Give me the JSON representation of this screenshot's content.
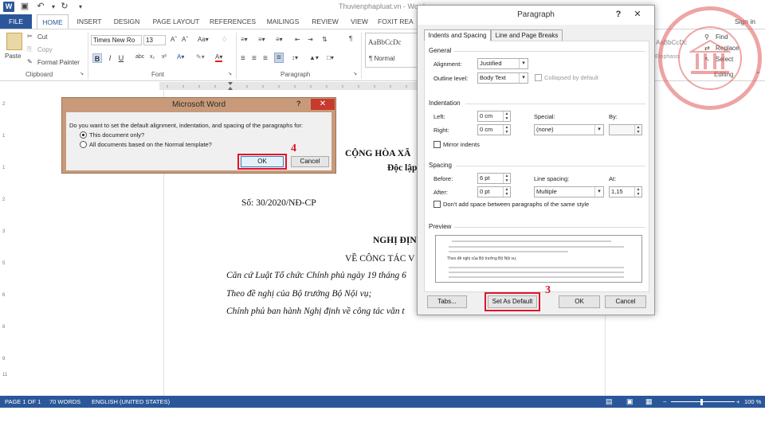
{
  "app": {
    "window_title": "Thuvienphapluat.vn - Word",
    "sign_in": "Sign in"
  },
  "qat": {
    "save_icon": "save-icon",
    "undo_icon": "undo-icon",
    "redo_icon": "redo-icon"
  },
  "tabs": [
    "FILE",
    "HOME",
    "INSERT",
    "DESIGN",
    "PAGE LAYOUT",
    "REFERENCES",
    "MAILINGS",
    "REVIEW",
    "VIEW",
    "FOXIT REA"
  ],
  "ribbon": {
    "clipboard": {
      "paste": "Paste",
      "cut": "Cut",
      "copy": "Copy",
      "format_painter": "Format Painter",
      "label": "Clipboard"
    },
    "font": {
      "font_name": "Times New Ro",
      "font_size": "13",
      "label": "Font"
    },
    "paragraph": {
      "label": "Paragraph"
    },
    "styles": {
      "preview": "AaBbCcDc",
      "normal": "¶ Normal"
    },
    "editing": {
      "find": "Find",
      "replace": "Replace",
      "select": "Select",
      "label": "Editing",
      "style_preview": "AaBbCcDc",
      "emphasis": "Emphasis"
    }
  },
  "document": {
    "heading1": "CỘNG HÒA XÃ",
    "heading2": "Độc lập",
    "number": "Số: 30/2020/NĐ-CP",
    "title1": "NGHỊ ĐỊN",
    "title2": "VỀ CÔNG TÁC V",
    "line1": "Căn cứ Luật Tổ chức Chính phủ ngày 19 tháng 6",
    "line2": "Theo đề nghị của Bộ trưởng Bộ Nội vụ;",
    "line3": "Chính phủ ban hành Nghị định về công tác văn t"
  },
  "status": {
    "page": "PAGE 1 OF 1",
    "words": "70 WORDS",
    "language": "ENGLISH (UNITED STATES)",
    "zoom": "100 %"
  },
  "paragraph_dialog": {
    "title": "Paragraph",
    "help": "?",
    "tabs": [
      "Indents and Spacing",
      "Line and Page Breaks"
    ],
    "general": {
      "label": "General",
      "alignment_label": "Alignment:",
      "alignment_value": "Justified",
      "outline_label": "Outline level:",
      "outline_value": "Body Text",
      "collapsed_label": "Collapsed by default"
    },
    "indentation": {
      "label": "Indentation",
      "left_label": "Left:",
      "left_value": "0 cm",
      "right_label": "Right:",
      "right_value": "0 cm",
      "special_label": "Special:",
      "special_value": "(none)",
      "by_label": "By:",
      "mirror_label": "Mirror indents"
    },
    "spacing": {
      "label": "Spacing",
      "before_label": "Before:",
      "before_value": "6 pt",
      "after_label": "After:",
      "after_value": "0 pt",
      "line_spacing_label": "Line spacing:",
      "line_spacing_value": "Multiple",
      "at_label": "At:",
      "at_value": "1,15",
      "dont_add_label": "Don't add space between paragraphs of the same style"
    },
    "preview": {
      "label": "Preview",
      "sample_text": "Theo đề nghị của Bộ trưởng Bộ Nội vụ;"
    },
    "buttons": {
      "tabs": "Tabs...",
      "set_default": "Set As Default",
      "ok": "OK",
      "cancel": "Cancel"
    },
    "step_marker": "3"
  },
  "msword_dialog": {
    "title": "Microsoft Word",
    "help": "?",
    "question": "Do you want to set the default alignment, indentation, and spacing of the paragraphs for:",
    "option1": "This document only?",
    "option2": "All documents based on the Normal template?",
    "ok": "OK",
    "cancel": "Cancel",
    "step_marker": "4"
  },
  "colors": {
    "accent": "#2b579a",
    "highlight": "#e0142b",
    "dialog_frame": "#c89a7a"
  }
}
